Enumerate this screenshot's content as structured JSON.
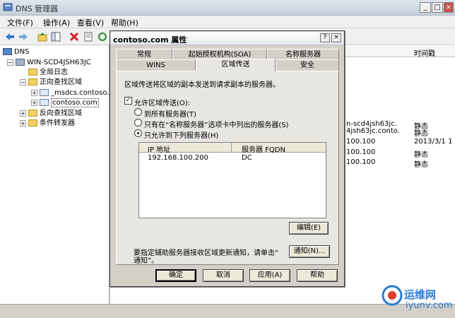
{
  "main_window": {
    "title": "DNS 管理器",
    "menu": [
      "文件(F)",
      "操作(A)",
      "查看(V)",
      "帮助(H)"
    ],
    "window_controls": [
      "_",
      "□",
      "×"
    ]
  },
  "tree": {
    "root": "DNS",
    "server": "WIN-SCD4JSH63JC",
    "global_log": "全局日志",
    "forward_zones": "正向查找区域",
    "msdcs_zone": "_msdcs.contoso.c",
    "contoso_zone": "contoso.com",
    "reverse_zones": "反向查找区域",
    "conditional_forwarders": "条件转发器"
  },
  "list_pane": {
    "timestamp_header": "时间戳",
    "rows": [
      {
        "left": "n-scd4jsh63jc.",
        "right": "静态"
      },
      {
        "left": "4jsh63jc.conto.",
        "right": "静态"
      },
      {
        "left": "100.100",
        "right": "2013/3/1 1"
      },
      {
        "left": "100.100",
        "right": "静态"
      },
      {
        "left": "100.100",
        "right": "静态"
      }
    ]
  },
  "dialog": {
    "title": "contoso.com 属性",
    "controls": [
      "?",
      "×"
    ],
    "tabs_row1": [
      "常规",
      "起始授权机构(SOA)",
      "名称服务器"
    ],
    "tabs_row2": [
      "WINS",
      "区域传送",
      "安全"
    ],
    "description": "区域传送将区域的副本发送到请求副本的服务器。",
    "allow_transfer_label": "允许区域传送(O):",
    "allow_transfer_checked": "✓",
    "radio_any": "到所有服务器(T)",
    "radio_ns_tab": "只有在“名称服务器”选项卡中列出的服务器(S)",
    "radio_listed": "只允许到下列服务器(H)",
    "server_list": {
      "columns": [
        "IP 地址",
        "服务器 FQDN"
      ],
      "rows": [
        {
          "ip": "192.168.100.200",
          "fqdn": "DC"
        }
      ]
    },
    "edit_button": "编辑(E)",
    "notify_text_line1": "要指定辅助服务器接收区域更新通知，请单击“",
    "notify_text_line2": "通知”。",
    "notify_button": "通知(N)...",
    "ok_button": "确定",
    "cancel_button": "取消",
    "apply_button": "应用(A)",
    "help_button": "帮助"
  },
  "watermark": {
    "site_name": "运维网",
    "site_url": "iyunv.com"
  }
}
